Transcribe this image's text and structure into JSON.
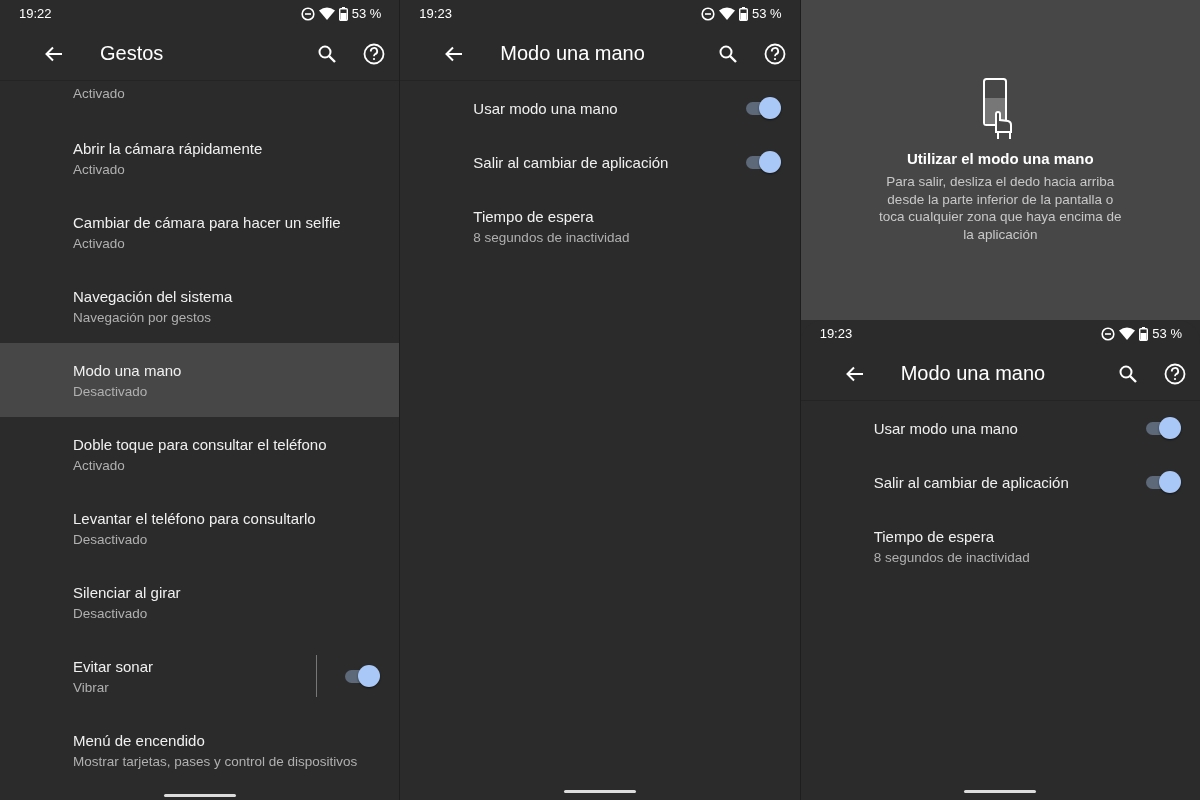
{
  "panels": [
    {
      "screen": {
        "status": {
          "time": "19:22",
          "battery": "53 %"
        },
        "title": "Gestos",
        "rows": [
          {
            "kind": "text",
            "subtitle": "Activado",
            "selected": false
          },
          {
            "kind": "text",
            "title": "Abrir la cámara rápidamente",
            "subtitle": "Activado",
            "selected": false
          },
          {
            "kind": "text",
            "title": "Cambiar de cámara para hacer un selfie",
            "subtitle": "Activado",
            "selected": false
          },
          {
            "kind": "text",
            "title": "Navegación del sistema",
            "subtitle": "Navegación por gestos",
            "selected": false
          },
          {
            "kind": "text",
            "title": "Modo una mano",
            "subtitle": "Desactivado",
            "selected": true
          },
          {
            "kind": "text",
            "title": "Doble toque para consultar el teléfono",
            "subtitle": "Activado",
            "selected": false
          },
          {
            "kind": "text",
            "title": "Levantar el teléfono para consultarlo",
            "subtitle": "Desactivado",
            "selected": false
          },
          {
            "kind": "text",
            "title": "Silenciar al girar",
            "subtitle": "Desactivado",
            "selected": false
          },
          {
            "kind": "split_toggle",
            "title": "Evitar sonar",
            "subtitle": "Vibrar",
            "on": true,
            "selected": false
          },
          {
            "kind": "text",
            "title": "Menú de encendido",
            "subtitle": "Mostrar tarjetas, pases y control de dispositivos",
            "selected": false
          }
        ]
      }
    },
    {
      "screen": {
        "status": {
          "time": "19:23",
          "battery": "53 %"
        },
        "title": "Modo una mano",
        "rows": [
          {
            "kind": "toggle",
            "title": "Usar modo una mano",
            "on": true
          },
          {
            "kind": "toggle",
            "title": "Salir al cambiar de aplicación",
            "on": true
          },
          {
            "kind": "text",
            "title": "Tiempo de espera",
            "subtitle": "8 segundos de inactividad"
          }
        ]
      }
    },
    {
      "overlay": {
        "title": "Utilizar el modo una mano",
        "text": "Para salir, desliza el dedo hacia arriba desde la parte inferior de la pantalla o toca cualquier zona que haya encima de la aplicación"
      },
      "screen": {
        "status": {
          "time": "19:23",
          "battery": "53 %"
        },
        "title": "Modo una mano",
        "rows": [
          {
            "kind": "toggle",
            "title": "Usar modo una mano",
            "on": true
          },
          {
            "kind": "toggle",
            "title": "Salir al cambiar de aplicación",
            "on": true
          },
          {
            "kind": "text",
            "title": "Tiempo de espera",
            "subtitle": "8 segundos de inactividad"
          }
        ]
      }
    }
  ]
}
